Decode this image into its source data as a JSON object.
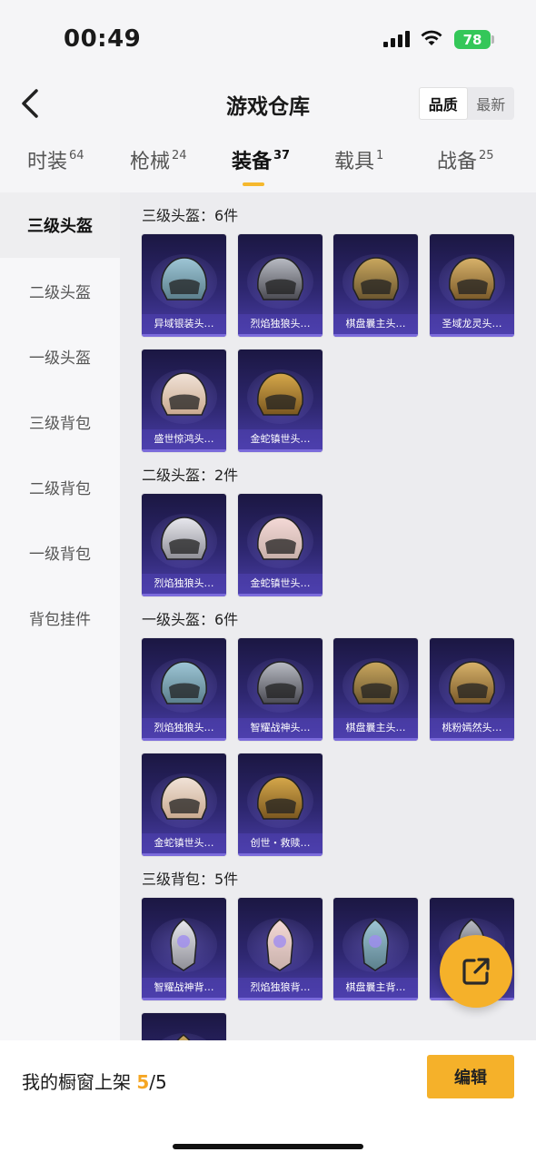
{
  "status_bar": {
    "time": "00:49",
    "battery": "78"
  },
  "nav": {
    "title": "游戏仓库",
    "sort_options": [
      "品质",
      "最新"
    ],
    "sort_selected": "品质"
  },
  "tabs": [
    {
      "label": "时装",
      "count": "64"
    },
    {
      "label": "枪械",
      "count": "24"
    },
    {
      "label": "装备",
      "count": "37"
    },
    {
      "label": "载具",
      "count": "1"
    },
    {
      "label": "战备",
      "count": "25"
    }
  ],
  "sidebar": [
    "三级头盔",
    "二级头盔",
    "一级头盔",
    "三级背包",
    "二级背包",
    "一级背包",
    "背包挂件"
  ],
  "sections": [
    {
      "title": "三级头盔：6件",
      "items": [
        "异域银装头…",
        "烈焰独狼头…",
        "棋盘曩主头…",
        "圣域龙灵头…",
        "盛世惊鸿头…",
        "金蛇镇世头…"
      ]
    },
    {
      "title": "二级头盔：2件",
      "items": [
        "烈焰独狼头…",
        "金蛇镇世头…"
      ]
    },
    {
      "title": "一级头盔：6件",
      "items": [
        "烈焰独狼头…",
        "智耀战神头…",
        "棋盘曩主头…",
        "桃粉嫣然头…",
        "金蛇镇世头…",
        "创世・救赎…"
      ]
    },
    {
      "title": "三级背包：5件",
      "items": [
        "智耀战神背…",
        "烈焰独狼背…",
        "棋盘曩主背…",
        "",
        ""
      ]
    }
  ],
  "bottom": {
    "shelf_label": "我的橱窗上架",
    "shelf_used": "5",
    "shelf_sep": "/",
    "shelf_total": "5",
    "edit_label": "编辑"
  },
  "colors": {
    "accent": "#f5b12a",
    "card_top": "#1b1742",
    "card_bottom": "#4a3ea8"
  }
}
